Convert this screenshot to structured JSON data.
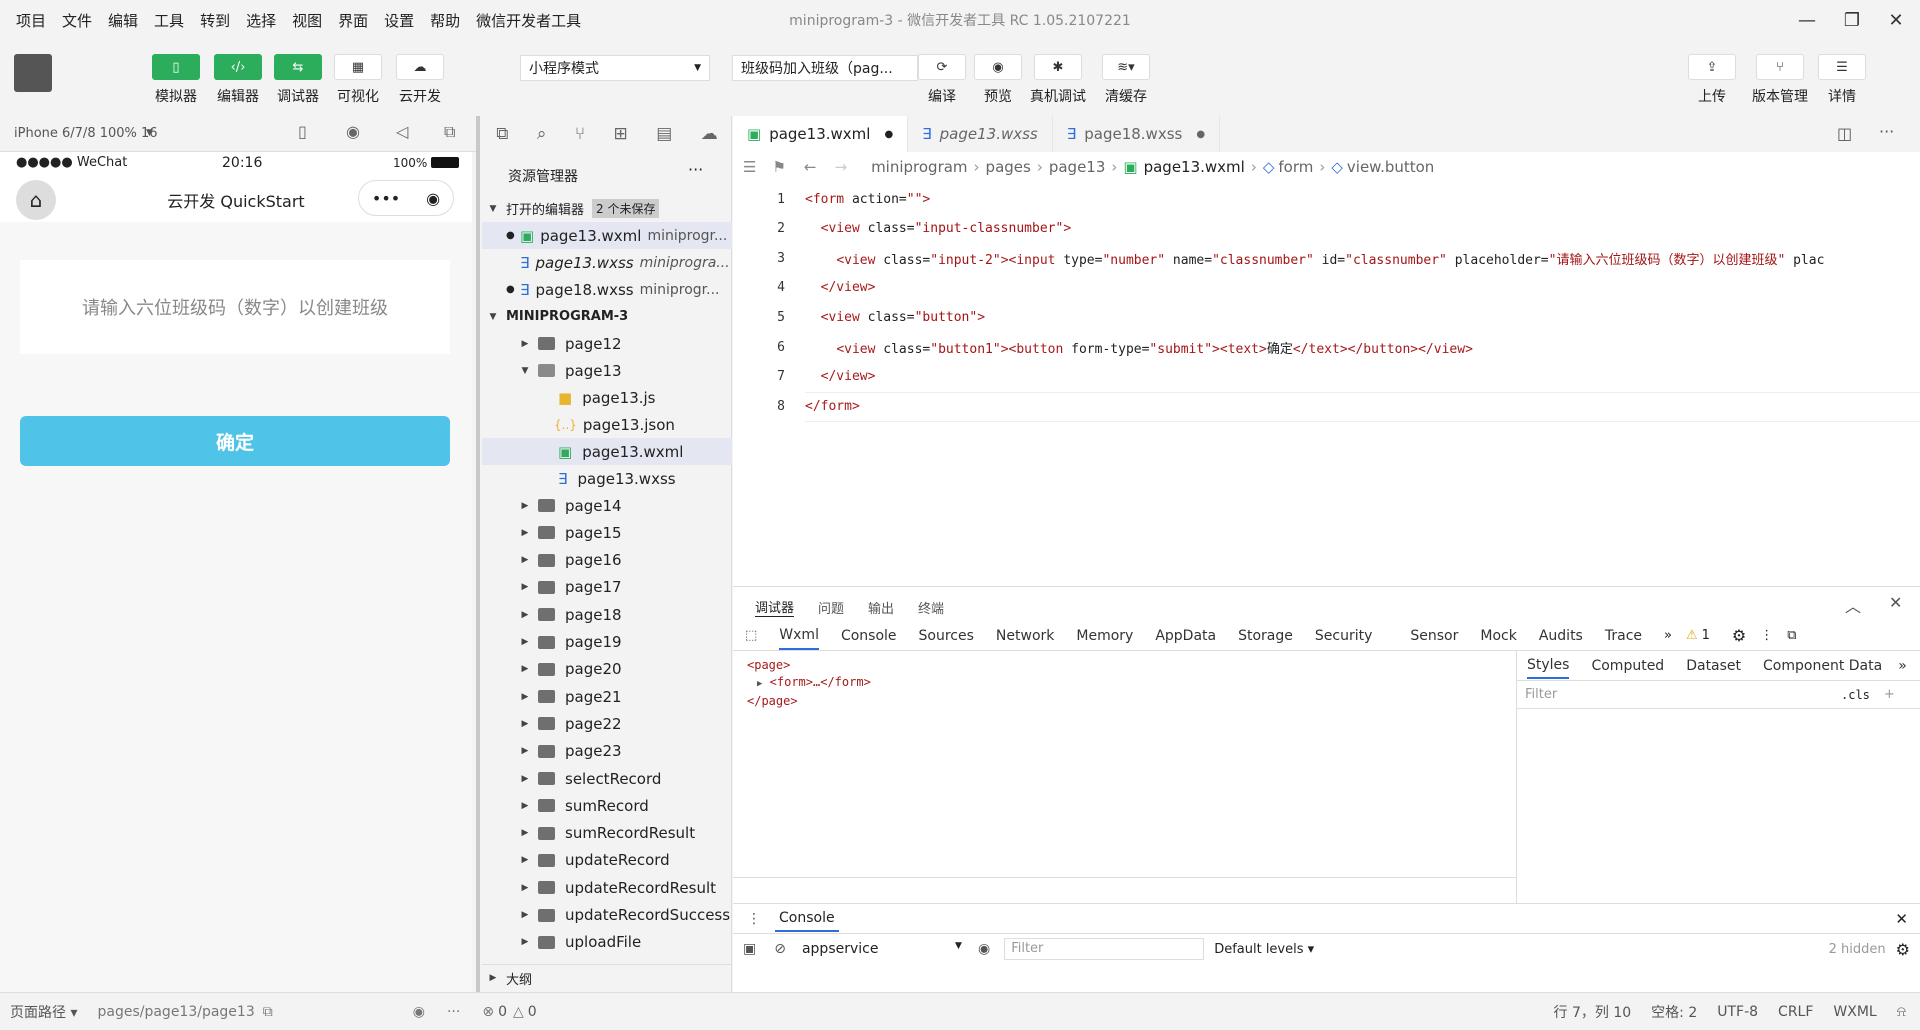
{
  "window": {
    "title": "miniprogram-3 - 微信开发者工具 RC 1.05.2107221"
  },
  "menu": [
    "项目",
    "文件",
    "编辑",
    "工具",
    "转到",
    "选择",
    "视图",
    "界面",
    "设置",
    "帮助",
    "微信开发者工具"
  ],
  "toolbar": {
    "simulator": "模拟器",
    "editor": "编辑器",
    "debugger": "调试器",
    "visual": "可视化",
    "cloud": "云开发",
    "mode": "小程序模式",
    "compile_target": "班级码加入班级（pag...",
    "compile": "编译",
    "preview": "预览",
    "real_debug": "真机调试",
    "clear_cache": "清缓存",
    "upload": "上传",
    "version": "版本管理",
    "details": "详情"
  },
  "simulator": {
    "device": "iPhone 6/7/8 100% 16",
    "status_carrier": "●●●●● WeChat",
    "status_time": "20:16",
    "status_battery": "100%",
    "nav_title": "云开发 QuickStart",
    "input_placeholder": "请输入六位班级码（数字）以创建班级",
    "confirm_button": "确定"
  },
  "explorer": {
    "title": "资源管理器",
    "open_editors": "打开的编辑器",
    "unsaved": "2 个未保存",
    "open_files": [
      {
        "name": "page13.wxml",
        "path": "miniprogr...",
        "dirty": true
      },
      {
        "name": "page13.wxss",
        "path": "miniprogra...",
        "dirty": false
      },
      {
        "name": "page18.wxss",
        "path": "miniprogr...",
        "dirty": true
      }
    ],
    "project": "MINIPROGRAM-3",
    "folders_before": [
      "page12"
    ],
    "open_folder": "page13",
    "page13_files": [
      "page13.js",
      "page13.json",
      "page13.wxml",
      "page13.wxss"
    ],
    "folders_after": [
      "page14",
      "page15",
      "page16",
      "page17",
      "page18",
      "page19",
      "page20",
      "page21",
      "page22",
      "page23",
      "selectRecord",
      "sumRecord",
      "sumRecordResult",
      "updateRecord",
      "updateRecordResult",
      "updateRecordSuccess",
      "uploadFile"
    ],
    "outline": "大纲"
  },
  "editor": {
    "tabs": [
      {
        "name": "page13.wxml",
        "dirty": true
      },
      {
        "name": "page13.wxss",
        "dirty": false
      },
      {
        "name": "page18.wxss",
        "dirty": true
      }
    ],
    "breadcrumb": [
      "miniprogram",
      "pages",
      "page13",
      "page13.wxml",
      "form",
      "view.button"
    ],
    "lines": [
      {
        "n": "1",
        "text": "<form action=\"\">"
      },
      {
        "n": "2",
        "text": "  <view class=\"input-classnumber\">"
      },
      {
        "n": "3",
        "text": "    <view class=\"input-2\"><input type=\"number\" name=\"classnumber\" id=\"classnumber\" placeholder=\"请输入六位班级码（数字）以创建班级\" plac"
      },
      {
        "n": "4",
        "text": "  </view>"
      },
      {
        "n": "5",
        "text": "  <view class=\"button\">"
      },
      {
        "n": "6",
        "text": "    <view class=\"button1\"><button form-type=\"submit\"><text>确定</text></button></view>"
      },
      {
        "n": "7",
        "text": "  </view>"
      },
      {
        "n": "8",
        "text": "</form>"
      }
    ]
  },
  "devtools": {
    "top_tabs": [
      "调试器",
      "问题",
      "输出",
      "终端"
    ],
    "tabs": [
      "Wxml",
      "Console",
      "Sources",
      "Network",
      "Memory",
      "AppData",
      "Storage",
      "Security",
      "Sensor",
      "Mock",
      "Audits",
      "Trace"
    ],
    "warning_count": "1",
    "dom": [
      "<page>",
      "<form>…</form>",
      "</page>"
    ],
    "style_tabs": [
      "Styles",
      "Computed",
      "Dataset",
      "Component Data"
    ],
    "filter_placeholder": "Filter",
    "cls": ".cls",
    "console_title": "Console",
    "context": "appservice",
    "console_filter": "Filter",
    "levels": "Default levels ▾",
    "hidden": "2 hidden"
  },
  "status": {
    "page_path_label": "页面路径 ▾",
    "page_path": "pages/page13/page13",
    "errors": "0",
    "warnings": "0",
    "cursor": "行 7，列 10",
    "spaces": "空格: 2",
    "encoding": "UTF-8",
    "eol": "CRLF",
    "lang": "WXML"
  },
  "colors": {
    "accent_green": "#2bad5b",
    "button_blue": "#4fc3e8"
  }
}
